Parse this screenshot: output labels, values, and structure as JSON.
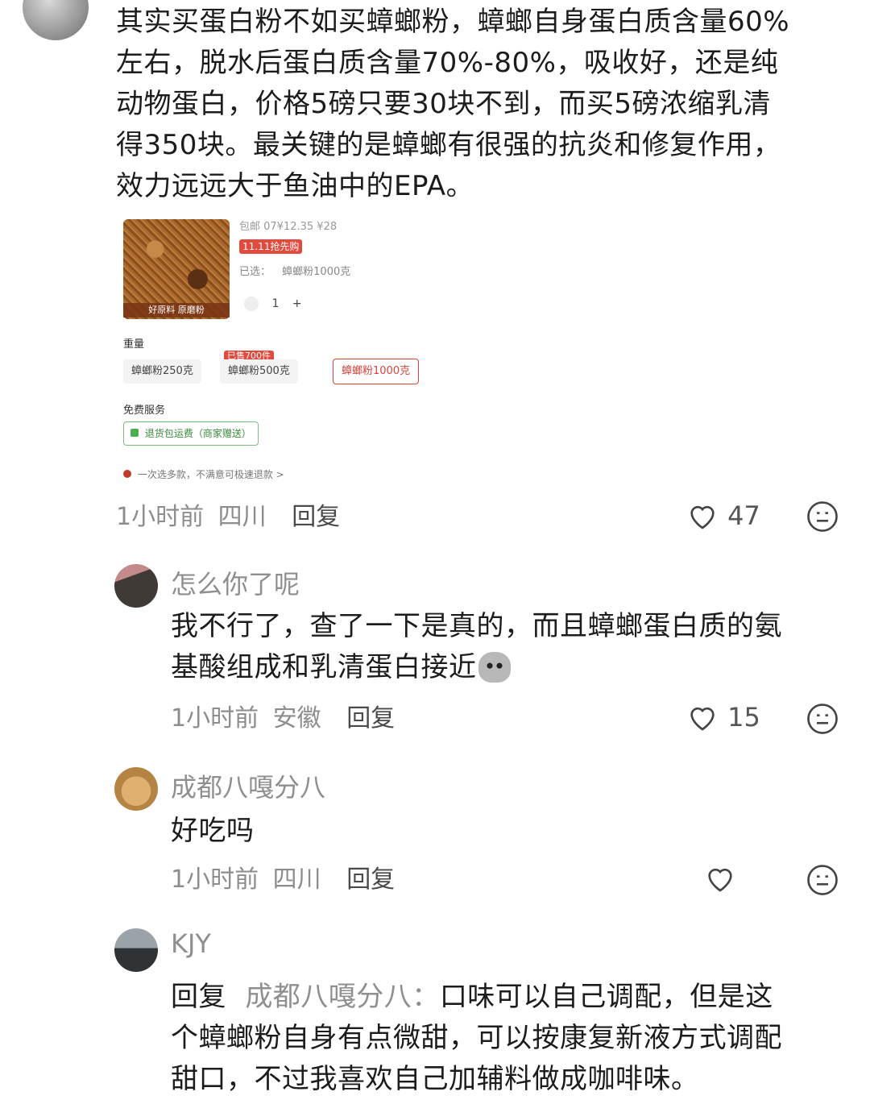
{
  "comment_top": {
    "text_lines": [
      "其实买蛋白粉不如买蟑螂粉，蟑螂自身蛋白质含量60%",
      "左右，脱水后蛋白质含量70%-80%，吸收好，还是纯",
      "动物蛋白，价格5磅只要30块不到，而买5磅浓缩乳清",
      "得350块。最关键的是蟑螂有很强的抗炎和修复作用，",
      "效力远远大于鱼油中的EPA。"
    ],
    "time": "1小时前",
    "location": "四川",
    "reply_label": "回复",
    "likes": "47"
  },
  "product": {
    "price_line": "包邮 07¥12.35 ¥28",
    "promo_tag": "11.11抢先购",
    "selected_label": "已选：",
    "selected_value": "蟑螂粉1000克",
    "image_caption": "好原料 原磨粉",
    "qty": "1",
    "qty_plus": "+",
    "weight_label": "重量",
    "options": [
      "蟑螂粉250克",
      "蟑螂粉500克",
      "蟑螂粉1000克"
    ],
    "hot_tag": "已售700件",
    "service_label": "免费服务",
    "service_value": "退货包运费（商家赠送）",
    "footer_note": "一次选多款，不满意可极速退款 >"
  },
  "comments": [
    {
      "name": "怎么你了呢",
      "lines": [
        "我不行了，查了一下是真的，而且蟑螂蛋白质的氨",
        "基酸组成和乳清蛋白接近"
      ],
      "time": "1小时前",
      "location": "安徽",
      "reply_label": "回复",
      "likes": "15"
    },
    {
      "name": "成都八嘎分八",
      "lines": [
        "好吃吗"
      ],
      "time": "1小时前",
      "location": "四川",
      "reply_label": "回复",
      "likes": ""
    },
    {
      "name": "KJY",
      "reply_prefix": "回复",
      "reply_to": "成都八嘎分八：",
      "lines": [
        "口味可以自己调配，但是这",
        "个蟑螂粉自身有点微甜，可以按康复新液方式调配",
        "甜口，不过我喜欢自己加辅料做成咖啡味。"
      ]
    }
  ],
  "icons": {
    "like": "heart-icon",
    "more": "emoji-face-icon"
  },
  "colors": {
    "accent_red": "#e24a3d",
    "meta_gray": "#8d8d8d"
  }
}
